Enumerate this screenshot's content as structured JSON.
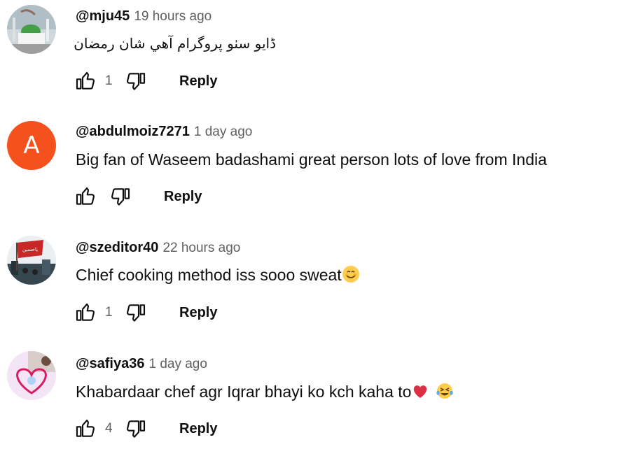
{
  "comments": [
    {
      "handle": "@mju45",
      "time": "19 hours ago",
      "text": "ڈايو سٺو پروگرام آهي شان رمضان",
      "likes": "1",
      "reply_label": "Reply",
      "avatar": "mosque-photo-avatar"
    },
    {
      "handle": "@abdulmoiz7271",
      "time": "1 day ago",
      "text": "Big fan of Waseem badashami  great person lots of love from India",
      "likes": "",
      "reply_label": "Reply",
      "avatar_letter": "A",
      "avatar_color": "#f4511e"
    },
    {
      "handle": "@szeditor40",
      "time": "22 hours ago",
      "text": "Chief cooking method iss sooo sweat",
      "text_emoji": "smiling-face-emoji",
      "likes": "1",
      "reply_label": "Reply",
      "avatar": "red-flag-photo-avatar"
    },
    {
      "handle": "@safiya36",
      "time": "1 day ago",
      "text": "Khabardaar chef agr Iqrar bhayi ko kch kaha to",
      "text_emoji": [
        "red-heart-emoji",
        "tears-of-joy-emoji"
      ],
      "likes": "4",
      "reply_label": "Reply",
      "avatar": "heart-art-avatar"
    }
  ],
  "icons": {
    "like": "thumbs-up-icon",
    "dislike": "thumbs-down-icon"
  },
  "colors": {
    "avatar_letter_bg": "#f4511e",
    "secondary_text": "#606060"
  }
}
